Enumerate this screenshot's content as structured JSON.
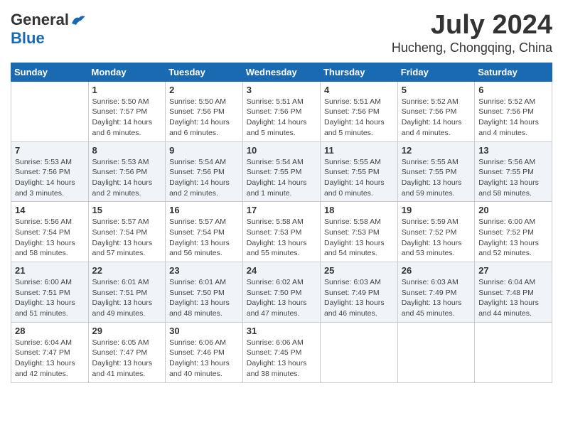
{
  "header": {
    "logo_general": "General",
    "logo_blue": "Blue",
    "month_year": "July 2024",
    "location": "Hucheng, Chongqing, China"
  },
  "columns": [
    "Sunday",
    "Monday",
    "Tuesday",
    "Wednesday",
    "Thursday",
    "Friday",
    "Saturday"
  ],
  "weeks": [
    [
      {
        "day": "",
        "info": ""
      },
      {
        "day": "1",
        "info": "Sunrise: 5:50 AM\nSunset: 7:57 PM\nDaylight: 14 hours\nand 6 minutes."
      },
      {
        "day": "2",
        "info": "Sunrise: 5:50 AM\nSunset: 7:56 PM\nDaylight: 14 hours\nand 6 minutes."
      },
      {
        "day": "3",
        "info": "Sunrise: 5:51 AM\nSunset: 7:56 PM\nDaylight: 14 hours\nand 5 minutes."
      },
      {
        "day": "4",
        "info": "Sunrise: 5:51 AM\nSunset: 7:56 PM\nDaylight: 14 hours\nand 5 minutes."
      },
      {
        "day": "5",
        "info": "Sunrise: 5:52 AM\nSunset: 7:56 PM\nDaylight: 14 hours\nand 4 minutes."
      },
      {
        "day": "6",
        "info": "Sunrise: 5:52 AM\nSunset: 7:56 PM\nDaylight: 14 hours\nand 4 minutes."
      }
    ],
    [
      {
        "day": "7",
        "info": "Sunrise: 5:53 AM\nSunset: 7:56 PM\nDaylight: 14 hours\nand 3 minutes."
      },
      {
        "day": "8",
        "info": "Sunrise: 5:53 AM\nSunset: 7:56 PM\nDaylight: 14 hours\nand 2 minutes."
      },
      {
        "day": "9",
        "info": "Sunrise: 5:54 AM\nSunset: 7:56 PM\nDaylight: 14 hours\nand 2 minutes."
      },
      {
        "day": "10",
        "info": "Sunrise: 5:54 AM\nSunset: 7:55 PM\nDaylight: 14 hours\nand 1 minute."
      },
      {
        "day": "11",
        "info": "Sunrise: 5:55 AM\nSunset: 7:55 PM\nDaylight: 14 hours\nand 0 minutes."
      },
      {
        "day": "12",
        "info": "Sunrise: 5:55 AM\nSunset: 7:55 PM\nDaylight: 13 hours\nand 59 minutes."
      },
      {
        "day": "13",
        "info": "Sunrise: 5:56 AM\nSunset: 7:55 PM\nDaylight: 13 hours\nand 58 minutes."
      }
    ],
    [
      {
        "day": "14",
        "info": "Sunrise: 5:56 AM\nSunset: 7:54 PM\nDaylight: 13 hours\nand 58 minutes."
      },
      {
        "day": "15",
        "info": "Sunrise: 5:57 AM\nSunset: 7:54 PM\nDaylight: 13 hours\nand 57 minutes."
      },
      {
        "day": "16",
        "info": "Sunrise: 5:57 AM\nSunset: 7:54 PM\nDaylight: 13 hours\nand 56 minutes."
      },
      {
        "day": "17",
        "info": "Sunrise: 5:58 AM\nSunset: 7:53 PM\nDaylight: 13 hours\nand 55 minutes."
      },
      {
        "day": "18",
        "info": "Sunrise: 5:58 AM\nSunset: 7:53 PM\nDaylight: 13 hours\nand 54 minutes."
      },
      {
        "day": "19",
        "info": "Sunrise: 5:59 AM\nSunset: 7:52 PM\nDaylight: 13 hours\nand 53 minutes."
      },
      {
        "day": "20",
        "info": "Sunrise: 6:00 AM\nSunset: 7:52 PM\nDaylight: 13 hours\nand 52 minutes."
      }
    ],
    [
      {
        "day": "21",
        "info": "Sunrise: 6:00 AM\nSunset: 7:51 PM\nDaylight: 13 hours\nand 51 minutes."
      },
      {
        "day": "22",
        "info": "Sunrise: 6:01 AM\nSunset: 7:51 PM\nDaylight: 13 hours\nand 49 minutes."
      },
      {
        "day": "23",
        "info": "Sunrise: 6:01 AM\nSunset: 7:50 PM\nDaylight: 13 hours\nand 48 minutes."
      },
      {
        "day": "24",
        "info": "Sunrise: 6:02 AM\nSunset: 7:50 PM\nDaylight: 13 hours\nand 47 minutes."
      },
      {
        "day": "25",
        "info": "Sunrise: 6:03 AM\nSunset: 7:49 PM\nDaylight: 13 hours\nand 46 minutes."
      },
      {
        "day": "26",
        "info": "Sunrise: 6:03 AM\nSunset: 7:49 PM\nDaylight: 13 hours\nand 45 minutes."
      },
      {
        "day": "27",
        "info": "Sunrise: 6:04 AM\nSunset: 7:48 PM\nDaylight: 13 hours\nand 44 minutes."
      }
    ],
    [
      {
        "day": "28",
        "info": "Sunrise: 6:04 AM\nSunset: 7:47 PM\nDaylight: 13 hours\nand 42 minutes."
      },
      {
        "day": "29",
        "info": "Sunrise: 6:05 AM\nSunset: 7:47 PM\nDaylight: 13 hours\nand 41 minutes."
      },
      {
        "day": "30",
        "info": "Sunrise: 6:06 AM\nSunset: 7:46 PM\nDaylight: 13 hours\nand 40 minutes."
      },
      {
        "day": "31",
        "info": "Sunrise: 6:06 AM\nSunset: 7:45 PM\nDaylight: 13 hours\nand 38 minutes."
      },
      {
        "day": "",
        "info": ""
      },
      {
        "day": "",
        "info": ""
      },
      {
        "day": "",
        "info": ""
      }
    ]
  ]
}
